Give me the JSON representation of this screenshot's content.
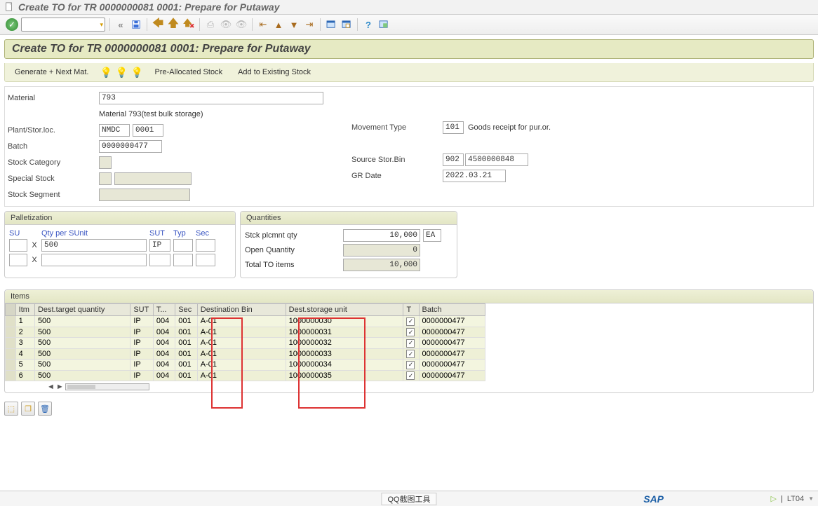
{
  "title": "Create TO for TR 0000000081 0001: Prepare for Putaway",
  "subtitle": "Create TO for TR 0000000081 0001: Prepare for Putaway",
  "actions": {
    "generate": "Generate + Next Mat.",
    "preallocated": "Pre-Allocated Stock",
    "addExisting": "Add to Existing Stock"
  },
  "left": {
    "material_lbl": "Material",
    "material": "793",
    "material_desc": "Material 793(test bulk storage)",
    "plant_lbl": "Plant/Stor.loc.",
    "plant": "NMDC",
    "sloc": "0001",
    "batch_lbl": "Batch",
    "batch": "0000000477",
    "stockcat_lbl": "Stock Category",
    "specstock_lbl": "Special Stock",
    "stockseg_lbl": "Stock Segment"
  },
  "right": {
    "movtype_lbl": "Movement Type",
    "movtype": "101",
    "movtype_desc": "Goods receipt for pur.or.",
    "srcbin_lbl": "Source Stor.Bin",
    "srcbin_1": "902",
    "srcbin_2": "4500000848",
    "grdate_lbl": "GR Date",
    "grdate": "2022.03.21"
  },
  "pal": {
    "title": "Palletization",
    "h_su": "SU",
    "h_qty": "Qty per SUnit",
    "h_sut": "SUT",
    "h_typ": "Typ",
    "h_sec": "Sec",
    "x": "X",
    "r1_qty": "500",
    "r1_sut": "IP"
  },
  "qty": {
    "title": "Quantities",
    "l1": "Stck plcmnt qty",
    "v1": "10,000",
    "ea": "EA",
    "l2": "Open Quantity",
    "v2": "0",
    "l3": "Total TO items",
    "v3": "10,000"
  },
  "items_title": "Items",
  "cols": {
    "itm": "Itm",
    "dtq": "Dest.target quantity",
    "sut": "SUT",
    "t": "T...",
    "sec": "Sec",
    "dbin": "Destination Bin",
    "dsu": "Dest.storage unit",
    "tc": "T",
    "batch": "Batch"
  },
  "rows": [
    {
      "itm": "1",
      "dtq": "500",
      "sut": "IP",
      "t": "004",
      "sec": "001",
      "dbin": "A-01",
      "dsu": "1000000030",
      "tc": true,
      "batch": "0000000477"
    },
    {
      "itm": "2",
      "dtq": "500",
      "sut": "IP",
      "t": "004",
      "sec": "001",
      "dbin": "A-01",
      "dsu": "1000000031",
      "tc": true,
      "batch": "0000000477"
    },
    {
      "itm": "3",
      "dtq": "500",
      "sut": "IP",
      "t": "004",
      "sec": "001",
      "dbin": "A-01",
      "dsu": "1000000032",
      "tc": true,
      "batch": "0000000477"
    },
    {
      "itm": "4",
      "dtq": "500",
      "sut": "IP",
      "t": "004",
      "sec": "001",
      "dbin": "A-01",
      "dsu": "1000000033",
      "tc": true,
      "batch": "0000000477"
    },
    {
      "itm": "5",
      "dtq": "500",
      "sut": "IP",
      "t": "004",
      "sec": "001",
      "dbin": "A-01",
      "dsu": "1000000034",
      "tc": true,
      "batch": "0000000477"
    },
    {
      "itm": "6",
      "dtq": "500",
      "sut": "IP",
      "t": "004",
      "sec": "001",
      "dbin": "A-01",
      "dsu": "1000000035",
      "tc": true,
      "batch": "0000000477"
    }
  ],
  "status": {
    "qq": "QQ截图工具",
    "tcode": "LT04"
  }
}
